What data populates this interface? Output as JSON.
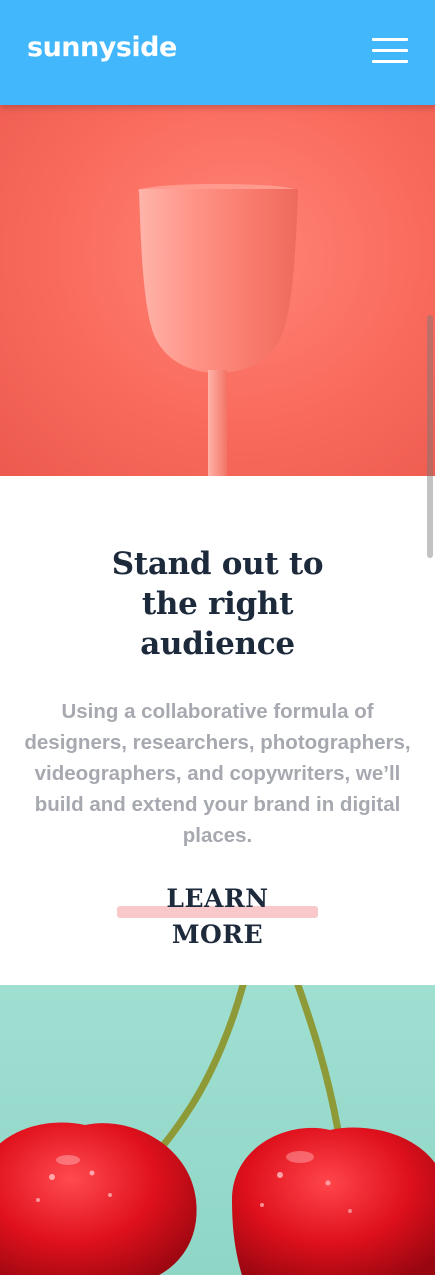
{
  "header": {
    "logo": "sunnyside",
    "menu_icon": "hamburger-menu-icon"
  },
  "images": {
    "top": "stemmed-glass-on-coral-background",
    "bottom": "cherries-on-mint-background"
  },
  "section": {
    "title_lines": [
      "Stand out to",
      "the right",
      "audience"
    ],
    "description_lines": [
      "Using a collaborative formula of",
      "designers, researchers, photographers,",
      "videographers, and copywriters, we’ll",
      "build and extend your brand in digital",
      "places."
    ],
    "cta_label": "LEARN MORE"
  },
  "colors": {
    "header_bg": "#43b7fb",
    "title": "#1d2a3b",
    "body_text": "#a7a9b0",
    "cta_underline": "#f8c8cb",
    "glass_bg": "#f96a5c",
    "cherry_bg": "#9fdfd1"
  }
}
